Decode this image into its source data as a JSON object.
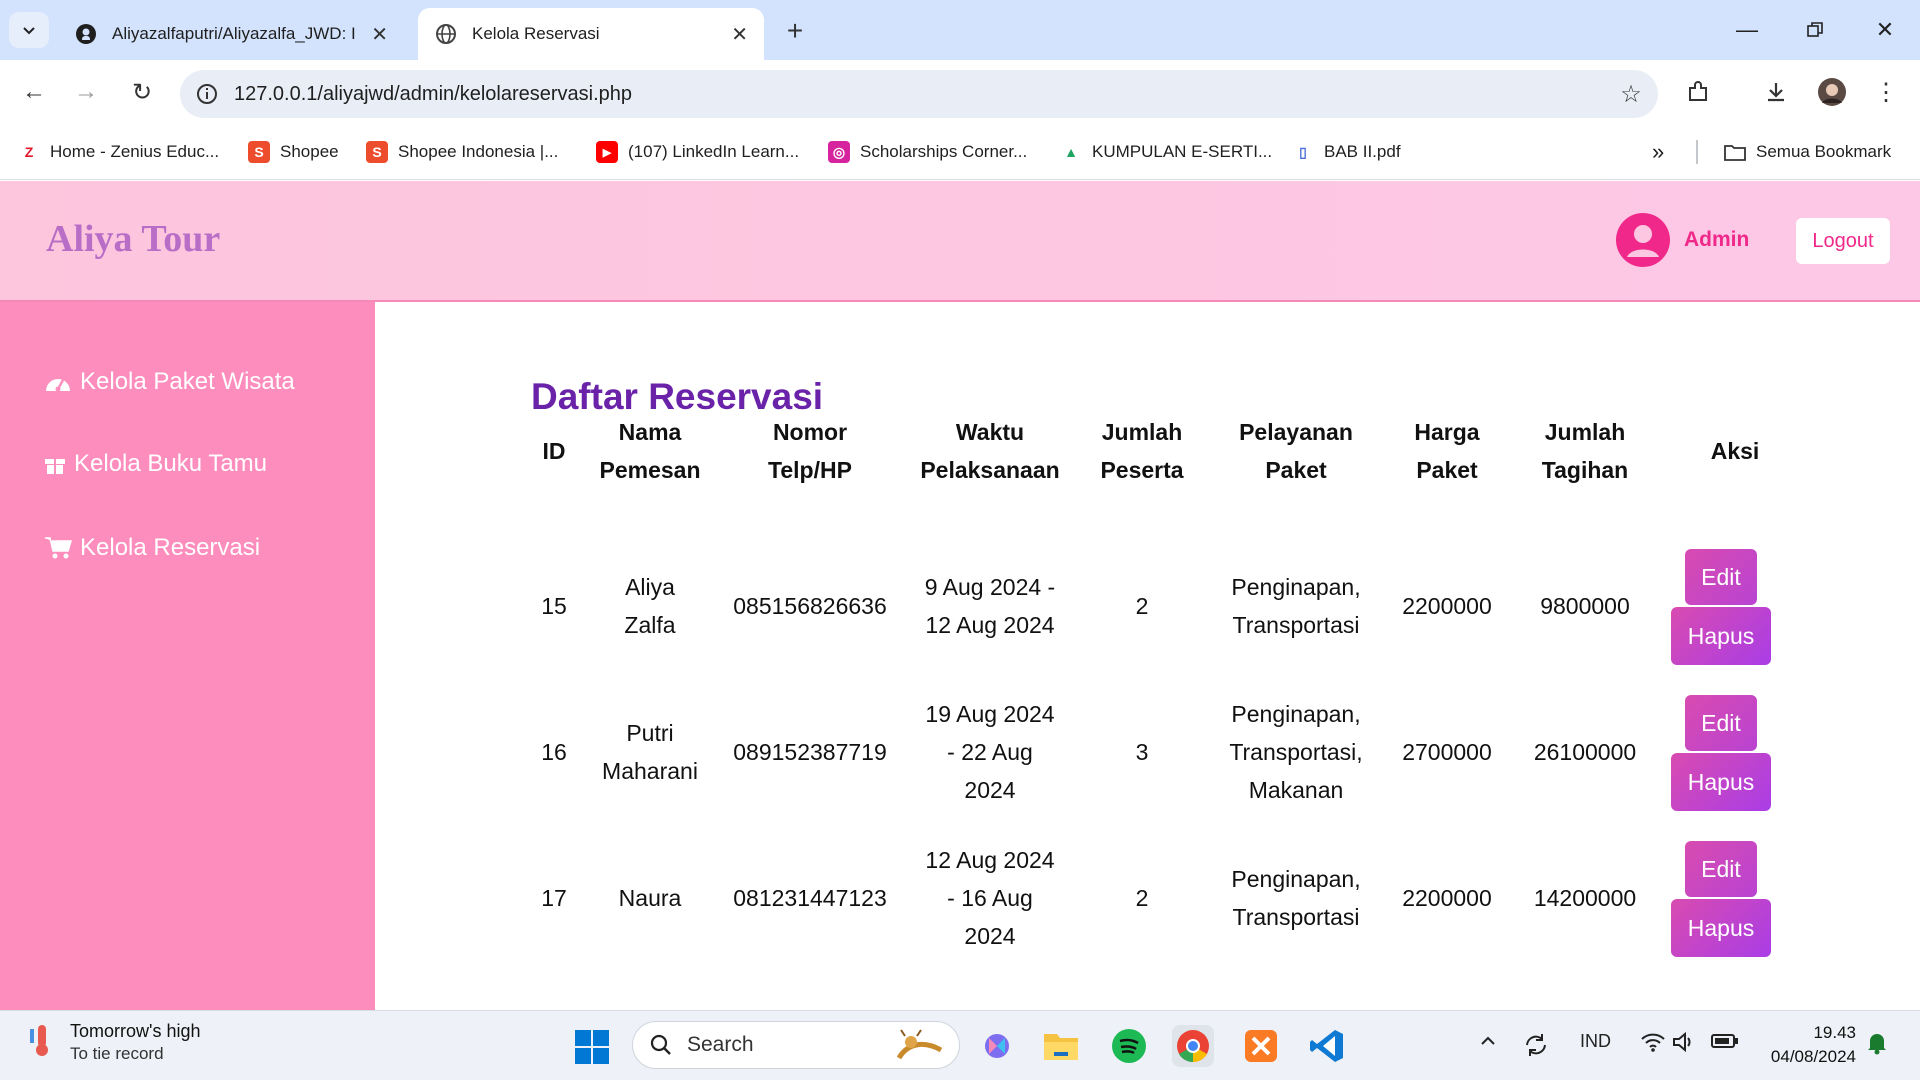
{
  "browser": {
    "tabs": [
      {
        "title": "Aliyazalfaputri/Aliyazalfa_JWD: I",
        "icon": "github-icon"
      },
      {
        "title": "Kelola Reservasi",
        "icon": "globe-icon"
      }
    ],
    "url": "127.0.0.1/aliyajwd/admin/kelolareservasi.php",
    "bookmarks": [
      {
        "label": "Home - Zenius Educ...",
        "icon": "Z"
      },
      {
        "label": "Shopee",
        "icon": "S"
      },
      {
        "label": "Shopee Indonesia |...",
        "icon": "S"
      },
      {
        "label": "(107) LinkedIn Learn...",
        "icon": "▶"
      },
      {
        "label": "Scholarships Corner...",
        "icon": "◎"
      },
      {
        "label": "KUMPULAN E-SERTI...",
        "icon": "▲"
      },
      {
        "label": "BAB II.pdf",
        "icon": "▯"
      }
    ],
    "more_bookmarks": "»",
    "all_bookmarks": "Semua Bookmark"
  },
  "site": {
    "brand": "Aliya Tour",
    "admin_label": "Admin",
    "logout_label": "Logout"
  },
  "sidebar": {
    "items": [
      {
        "label": "Kelola Paket Wisata",
        "icon": "dashboard-icon"
      },
      {
        "label": "Kelola Buku Tamu",
        "icon": "gift-icon"
      },
      {
        "label": "Kelola Reservasi",
        "icon": "cart-icon"
      }
    ]
  },
  "main": {
    "title": "Daftar Reservasi",
    "columns": [
      [
        "ID"
      ],
      [
        "Nama",
        "Pemesan"
      ],
      [
        "Nomor",
        "Telp/HP"
      ],
      [
        "Waktu",
        "Pelaksanaan"
      ],
      [
        "Jumlah",
        "Peserta"
      ],
      [
        "Pelayanan",
        "Paket"
      ],
      [
        "Harga",
        "Paket"
      ],
      [
        "Jumlah",
        "Tagihan"
      ],
      [
        "Aksi"
      ]
    ],
    "rows": [
      {
        "id": "15",
        "nama": [
          "Aliya",
          "Zalfa"
        ],
        "telp": "085156826636",
        "waktu": [
          "9 Aug 2024 -",
          "12 Aug 2024"
        ],
        "peserta": "2",
        "pelayanan": [
          "Penginapan,",
          "Transportasi"
        ],
        "harga": "2200000",
        "tagihan": "9800000"
      },
      {
        "id": "16",
        "nama": [
          "Putri",
          "Maharani"
        ],
        "telp": "089152387719",
        "waktu": [
          "19 Aug 2024",
          "- 22 Aug",
          "2024"
        ],
        "peserta": "3",
        "pelayanan": [
          "Penginapan,",
          "Transportasi,",
          "Makanan"
        ],
        "harga": "2700000",
        "tagihan": "26100000"
      },
      {
        "id": "17",
        "nama": [
          "Naura"
        ],
        "telp": "081231447123",
        "waktu": [
          "12 Aug 2024",
          "- 16 Aug",
          "2024"
        ],
        "peserta": "2",
        "pelayanan": [
          "Penginapan,",
          "Transportasi"
        ],
        "harga": "2200000",
        "tagihan": "14200000"
      }
    ],
    "edit_label": "Edit",
    "delete_label": "Hapus"
  },
  "taskbar": {
    "weather_title": "Tomorrow's high",
    "weather_sub": "To tie record",
    "search_label": "Search",
    "language": "IND",
    "time": "19.43",
    "date": "04/08/2024"
  },
  "colors": {
    "header_bg": "#fdc6dd",
    "sidebar_bg": "#fd8dbd",
    "brand": "#b86dc7",
    "accent": "#f0288a",
    "title": "#6a22a8",
    "button": "#c445c8"
  }
}
